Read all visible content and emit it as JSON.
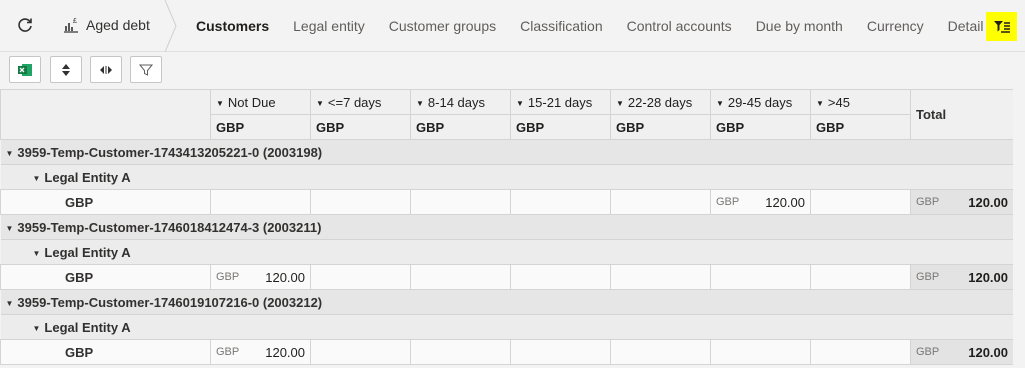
{
  "header": {
    "app_title": "Aged debt",
    "tabs": [
      "Customers",
      "Legal entity",
      "Customer groups",
      "Classification",
      "Control accounts",
      "Due by month",
      "Currency",
      "Detail"
    ],
    "active_tab": "Customers",
    "accent": "#ffff00"
  },
  "toolbar": {
    "buttons": [
      "excel-export-icon",
      "sort-icon",
      "expand-collapse-icon",
      "filter-icon"
    ]
  },
  "grid": {
    "columns": [
      "Not Due",
      "<=7 days",
      "8-14 days",
      "15-21 days",
      "22-28 days",
      "29-45 days",
      ">45"
    ],
    "currency_row": [
      "GBP",
      "GBP",
      "GBP",
      "GBP",
      "GBP",
      "GBP",
      "GBP"
    ],
    "total_label": "Total",
    "groups": [
      {
        "customer": "3959-Temp-Customer-1743413205221-0 (2003198)",
        "legal_entity": "Legal Entity A",
        "row_label": "GBP",
        "cells": [
          "",
          "",
          "",
          "",
          "",
          "120.00",
          ""
        ],
        "cell_currency": "GBP",
        "total": "120.00"
      },
      {
        "customer": "3959-Temp-Customer-1746018412474-3 (2003211)",
        "legal_entity": "Legal Entity A",
        "row_label": "GBP",
        "cells": [
          "120.00",
          "",
          "",
          "",
          "",
          "",
          ""
        ],
        "cell_currency": "GBP",
        "total": "120.00"
      },
      {
        "customer": "3959-Temp-Customer-1746019107216-0 (2003212)",
        "legal_entity": "Legal Entity A",
        "row_label": "GBP",
        "cells": [
          "120.00",
          "",
          "",
          "",
          "",
          "",
          ""
        ],
        "cell_currency": "GBP",
        "total": "120.00"
      }
    ]
  }
}
